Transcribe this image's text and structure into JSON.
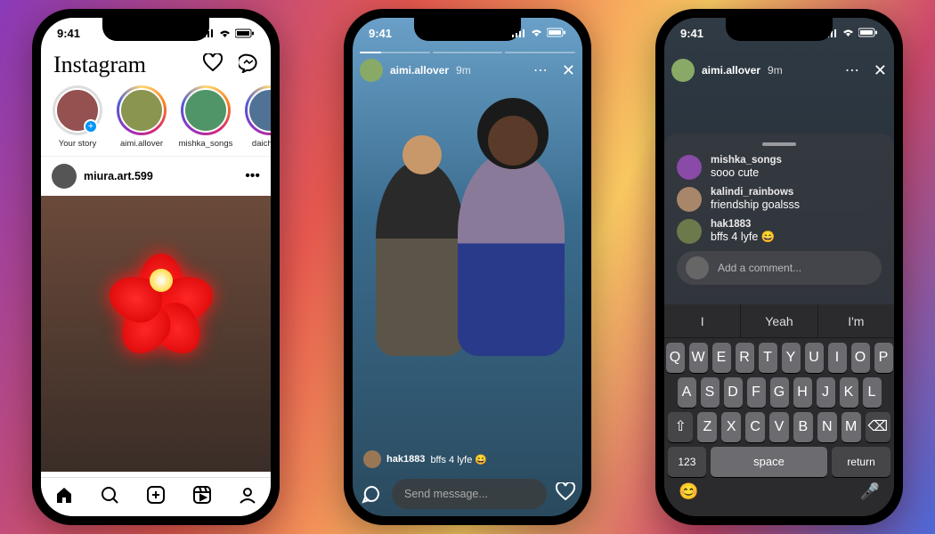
{
  "status": {
    "time": "9:41"
  },
  "feed": {
    "logo": "Instagram",
    "stories": [
      {
        "label": "Your story",
        "self": true
      },
      {
        "label": "aimi.allover"
      },
      {
        "label": "mishka_songs"
      },
      {
        "label": "daichiguy"
      }
    ],
    "post": {
      "username": "miura.art.599"
    },
    "tabs": [
      "home",
      "search",
      "create",
      "reels",
      "profile"
    ]
  },
  "story": {
    "username": "aimi.allover",
    "time_ago": "9m",
    "comment_user": "hak1883",
    "comment_text": "bffs 4 lyfe 😄",
    "reply_placeholder": "Send message..."
  },
  "sheet": {
    "comments": [
      {
        "user": "mishka_songs",
        "text": "sooo cute",
        "color": "#8a4aa8"
      },
      {
        "user": "kalindi_rainbows",
        "text": "friendship goalsss",
        "color": "#a8866a"
      },
      {
        "user": "hak1883",
        "text": "bffs 4 lyfe 😄",
        "color": "#6a7a4a"
      }
    ],
    "placeholder": "Add a comment..."
  },
  "keyboard": {
    "suggestions": [
      "I",
      "Yeah",
      "I'm"
    ],
    "row1": [
      "Q",
      "W",
      "E",
      "R",
      "T",
      "Y",
      "U",
      "I",
      "O",
      "P"
    ],
    "row2": [
      "A",
      "S",
      "D",
      "F",
      "G",
      "H",
      "J",
      "K",
      "L"
    ],
    "row3": [
      "Z",
      "X",
      "C",
      "V",
      "B",
      "N",
      "M"
    ],
    "shift": "⇧",
    "backspace": "⌫",
    "numbers": "123",
    "space": "space",
    "return": "return",
    "emoji": "😊",
    "mic": "🎤"
  }
}
